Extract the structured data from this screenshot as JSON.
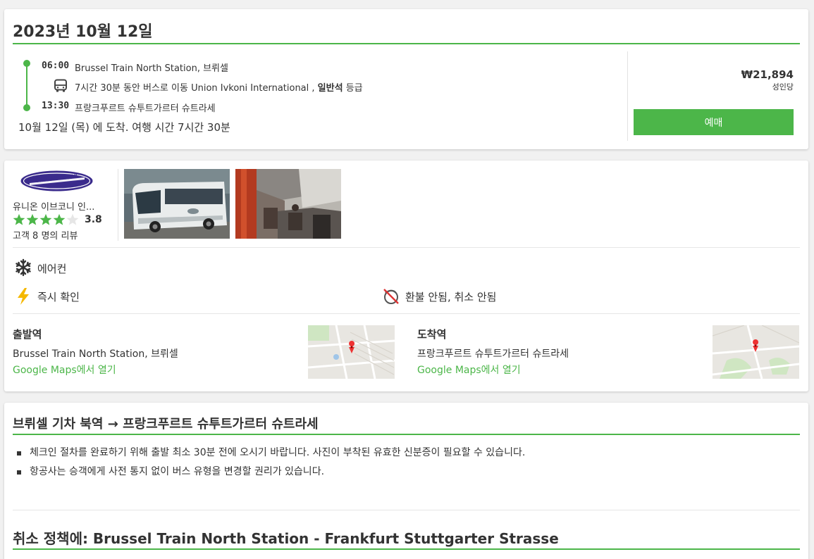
{
  "trip": {
    "date_title": "2023년 10월 12일",
    "departure_time": "06:00",
    "departure_station": "Brussel Train North Station, 브뤼셀",
    "travel_prefix": "7시간 30분 동안 버스로 이동 Union Ivkoni International ,",
    "travel_class": "일반석",
    "travel_suffix": "등급",
    "arrival_time": "13:30",
    "arrival_station": "프랑크푸르트 슈투트가르터 슈트라세",
    "arrival_summary": "10월 12일 (목) 에 도착. 여행 시간 7시간 30분",
    "price": "₩21,894",
    "per_person": "성인당",
    "book_label": "예매"
  },
  "operator": {
    "logo_text": "UNION IVKONI",
    "name": "유니온 이브코니 인...",
    "rating": "3.8",
    "stars_filled": 4,
    "reviews": "고객 8 명의 리뷰"
  },
  "amenities": {
    "ac": "에어컨",
    "instant": "즉시 확인",
    "refund": "환불 안됨, 취소 안됨"
  },
  "stations": {
    "departure_title": "출발역",
    "departure_name": "Brussel Train North Station, 브뤼셀",
    "departure_link": "Google Maps에서 열기",
    "arrival_title": "도착역",
    "arrival_name": "프랑크푸르트 슈투트가르터 슈트라세",
    "arrival_link": "Google Maps에서 열기"
  },
  "info": {
    "route_title": "브뤼셀 기차 북역 → 프랑크푸르트 슈투트가르터 슈트라세",
    "notes": [
      "체크인 절차를 완료하기 위해 출발 최소 30분 전에 오시기 바랍니다. 사진이 부착된 유효한 신분증이 필요할 수 있습니다.",
      "항공사는 승객에게 사전 통지 없이 버스 유형을 변경할 권리가 있습니다."
    ],
    "cancel_title": "취소 정책에: Brussel Train North Station - Frankfurt Stuttgarter Strasse"
  },
  "colors": {
    "accent": "#4cb649",
    "star": "#4cb649",
    "logo": "#3a2b8c"
  }
}
